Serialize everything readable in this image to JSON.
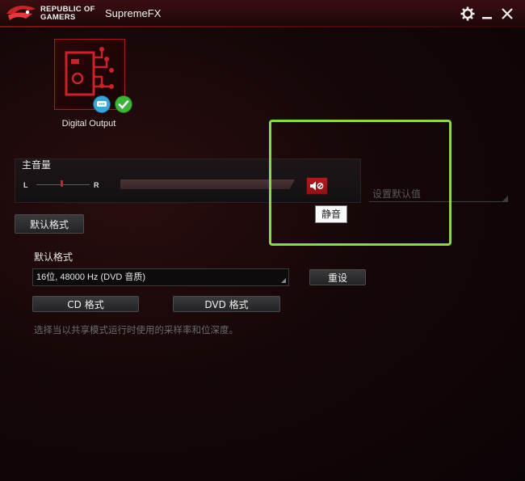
{
  "titlebar": {
    "brand_line1": "REPUBLIC OF",
    "brand_line2": "GAMERS",
    "app_title": "SupremeFX",
    "buttons": [
      "gear-icon",
      "minimize-icon",
      "close-icon"
    ]
  },
  "device": {
    "label": "Digital Output",
    "badges": [
      "chat-icon",
      "check-icon"
    ]
  },
  "volume": {
    "title": "主音量",
    "left_label": "L",
    "right_label": "R",
    "mute_tooltip": "静音",
    "default_placeholder": "设置默认值"
  },
  "tabs": {
    "default_format": "默认格式"
  },
  "format": {
    "section_label": "默认格式",
    "selected": "16位, 48000 Hz (DVD 音质)",
    "reset_button": "重设",
    "cd_button": "CD 格式",
    "dvd_button": "DVD 格式",
    "hint": "选择当以共享模式运行时使用的采样率和位深度。"
  },
  "colors": {
    "accent": "#c9232a",
    "highlight_box": "#8fd64a"
  }
}
